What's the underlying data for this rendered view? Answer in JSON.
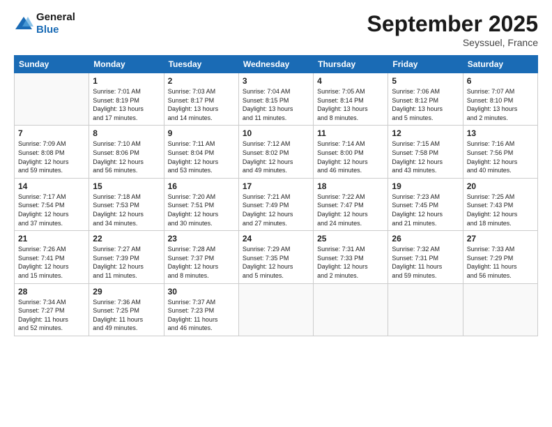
{
  "header": {
    "logo_line1": "General",
    "logo_line2": "Blue",
    "month": "September 2025",
    "location": "Seyssuel, France"
  },
  "days_of_week": [
    "Sunday",
    "Monday",
    "Tuesday",
    "Wednesday",
    "Thursday",
    "Friday",
    "Saturday"
  ],
  "weeks": [
    [
      {
        "day": "",
        "info": ""
      },
      {
        "day": "1",
        "info": "Sunrise: 7:01 AM\nSunset: 8:19 PM\nDaylight: 13 hours\nand 17 minutes."
      },
      {
        "day": "2",
        "info": "Sunrise: 7:03 AM\nSunset: 8:17 PM\nDaylight: 13 hours\nand 14 minutes."
      },
      {
        "day": "3",
        "info": "Sunrise: 7:04 AM\nSunset: 8:15 PM\nDaylight: 13 hours\nand 11 minutes."
      },
      {
        "day": "4",
        "info": "Sunrise: 7:05 AM\nSunset: 8:14 PM\nDaylight: 13 hours\nand 8 minutes."
      },
      {
        "day": "5",
        "info": "Sunrise: 7:06 AM\nSunset: 8:12 PM\nDaylight: 13 hours\nand 5 minutes."
      },
      {
        "day": "6",
        "info": "Sunrise: 7:07 AM\nSunset: 8:10 PM\nDaylight: 13 hours\nand 2 minutes."
      }
    ],
    [
      {
        "day": "7",
        "info": "Sunrise: 7:09 AM\nSunset: 8:08 PM\nDaylight: 12 hours\nand 59 minutes."
      },
      {
        "day": "8",
        "info": "Sunrise: 7:10 AM\nSunset: 8:06 PM\nDaylight: 12 hours\nand 56 minutes."
      },
      {
        "day": "9",
        "info": "Sunrise: 7:11 AM\nSunset: 8:04 PM\nDaylight: 12 hours\nand 53 minutes."
      },
      {
        "day": "10",
        "info": "Sunrise: 7:12 AM\nSunset: 8:02 PM\nDaylight: 12 hours\nand 49 minutes."
      },
      {
        "day": "11",
        "info": "Sunrise: 7:14 AM\nSunset: 8:00 PM\nDaylight: 12 hours\nand 46 minutes."
      },
      {
        "day": "12",
        "info": "Sunrise: 7:15 AM\nSunset: 7:58 PM\nDaylight: 12 hours\nand 43 minutes."
      },
      {
        "day": "13",
        "info": "Sunrise: 7:16 AM\nSunset: 7:56 PM\nDaylight: 12 hours\nand 40 minutes."
      }
    ],
    [
      {
        "day": "14",
        "info": "Sunrise: 7:17 AM\nSunset: 7:54 PM\nDaylight: 12 hours\nand 37 minutes."
      },
      {
        "day": "15",
        "info": "Sunrise: 7:18 AM\nSunset: 7:53 PM\nDaylight: 12 hours\nand 34 minutes."
      },
      {
        "day": "16",
        "info": "Sunrise: 7:20 AM\nSunset: 7:51 PM\nDaylight: 12 hours\nand 30 minutes."
      },
      {
        "day": "17",
        "info": "Sunrise: 7:21 AM\nSunset: 7:49 PM\nDaylight: 12 hours\nand 27 minutes."
      },
      {
        "day": "18",
        "info": "Sunrise: 7:22 AM\nSunset: 7:47 PM\nDaylight: 12 hours\nand 24 minutes."
      },
      {
        "day": "19",
        "info": "Sunrise: 7:23 AM\nSunset: 7:45 PM\nDaylight: 12 hours\nand 21 minutes."
      },
      {
        "day": "20",
        "info": "Sunrise: 7:25 AM\nSunset: 7:43 PM\nDaylight: 12 hours\nand 18 minutes."
      }
    ],
    [
      {
        "day": "21",
        "info": "Sunrise: 7:26 AM\nSunset: 7:41 PM\nDaylight: 12 hours\nand 15 minutes."
      },
      {
        "day": "22",
        "info": "Sunrise: 7:27 AM\nSunset: 7:39 PM\nDaylight: 12 hours\nand 11 minutes."
      },
      {
        "day": "23",
        "info": "Sunrise: 7:28 AM\nSunset: 7:37 PM\nDaylight: 12 hours\nand 8 minutes."
      },
      {
        "day": "24",
        "info": "Sunrise: 7:29 AM\nSunset: 7:35 PM\nDaylight: 12 hours\nand 5 minutes."
      },
      {
        "day": "25",
        "info": "Sunrise: 7:31 AM\nSunset: 7:33 PM\nDaylight: 12 hours\nand 2 minutes."
      },
      {
        "day": "26",
        "info": "Sunrise: 7:32 AM\nSunset: 7:31 PM\nDaylight: 11 hours\nand 59 minutes."
      },
      {
        "day": "27",
        "info": "Sunrise: 7:33 AM\nSunset: 7:29 PM\nDaylight: 11 hours\nand 56 minutes."
      }
    ],
    [
      {
        "day": "28",
        "info": "Sunrise: 7:34 AM\nSunset: 7:27 PM\nDaylight: 11 hours\nand 52 minutes."
      },
      {
        "day": "29",
        "info": "Sunrise: 7:36 AM\nSunset: 7:25 PM\nDaylight: 11 hours\nand 49 minutes."
      },
      {
        "day": "30",
        "info": "Sunrise: 7:37 AM\nSunset: 7:23 PM\nDaylight: 11 hours\nand 46 minutes."
      },
      {
        "day": "",
        "info": ""
      },
      {
        "day": "",
        "info": ""
      },
      {
        "day": "",
        "info": ""
      },
      {
        "day": "",
        "info": ""
      }
    ]
  ]
}
